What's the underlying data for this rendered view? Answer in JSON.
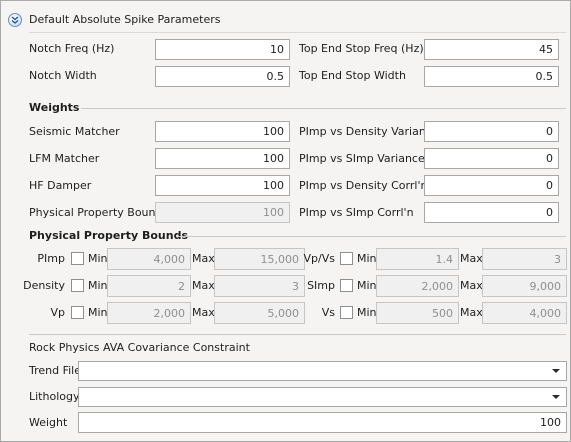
{
  "panel": {
    "title": "Default Absolute Spike Parameters"
  },
  "spike": {
    "notch_freq_label": "Notch Freq (Hz)",
    "notch_freq_value": "10",
    "notch_width_label": "Notch Width",
    "notch_width_value": "0.5",
    "top_end_stop_freq_label": "Top End Stop Freq (Hz)",
    "top_end_stop_freq_value": "45",
    "top_end_stop_width_label": "Top End Stop Width",
    "top_end_stop_width_value": "0.5"
  },
  "weights": {
    "heading": "Weights",
    "seismic_matcher_label": "Seismic Matcher",
    "seismic_matcher_value": "100",
    "lfm_matcher_label": "LFM Matcher",
    "lfm_matcher_value": "100",
    "hf_damper_label": "HF Damper",
    "hf_damper_value": "100",
    "physical_property_bounds_label": "Physical Property Bounds",
    "physical_property_bounds_value": "100",
    "pimp_density_variance_label": "PImp vs Density Variance",
    "pimp_density_variance_value": "0",
    "pimp_simp_variance_label": "PImp vs SImp Variance",
    "pimp_simp_variance_value": "0",
    "pimp_density_corrln_label": "PImp vs Density Corrl'n",
    "pimp_density_corrln_value": "0",
    "pimp_simp_corrln_label": "PImp vs SImp Corrl'n",
    "pimp_simp_corrln_value": "0"
  },
  "bounds": {
    "heading": "Physical Property Bounds",
    "min_label": "Min",
    "max_label": "Max",
    "pimp": {
      "label": "PImp",
      "min": "4,000",
      "max": "15,000",
      "checked": false
    },
    "density": {
      "label": "Density",
      "min": "2",
      "max": "3",
      "checked": false
    },
    "vp": {
      "label": "Vp",
      "min": "2,000",
      "max": "5,000",
      "checked": false
    },
    "vpvs": {
      "label": "Vp/Vs",
      "min": "1.4",
      "max": "3",
      "checked": false
    },
    "simp": {
      "label": "SImp",
      "min": "2,000",
      "max": "9,000",
      "checked": false
    },
    "vs": {
      "label": "Vs",
      "min": "500",
      "max": "4,000",
      "checked": false
    }
  },
  "rock_physics": {
    "heading": "Rock Physics AVA Covariance Constraint",
    "trend_file_label": "Trend File",
    "trend_file_value": "",
    "lithology_label": "Lithology",
    "lithology_value": "",
    "weight_label": "Weight",
    "weight_value": "100"
  },
  "icons": {
    "collapse": "collapse-chevron-icon",
    "dropdown": "dropdown-arrow-icon"
  }
}
